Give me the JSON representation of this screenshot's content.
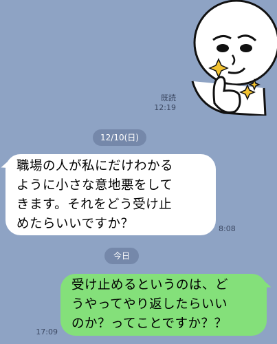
{
  "colors": {
    "background": "#8ea3c4",
    "incoming_bubble": "#ffffff",
    "outgoing_bubble": "#84e07a",
    "date_pill": "#7588aa"
  },
  "sticker": {
    "icon": "thumbs-up-sticker-icon"
  },
  "first_message": {
    "read_label": "既読",
    "time": "12:19"
  },
  "date_separator_1": {
    "label": "12/10(日)"
  },
  "incoming_message": {
    "lines": [
      "職場の人が私にだけわかる",
      "ように小さな意地悪をして",
      "きます。それをどう受け止",
      "めたらいいですか？"
    ],
    "time": "8:08"
  },
  "date_separator_2": {
    "label": "今日"
  },
  "outgoing_message": {
    "lines": [
      "受け止めるというのは、ど",
      "うやってやり返したらいい",
      "のか？ってことですか？？"
    ],
    "time": "17:09"
  }
}
